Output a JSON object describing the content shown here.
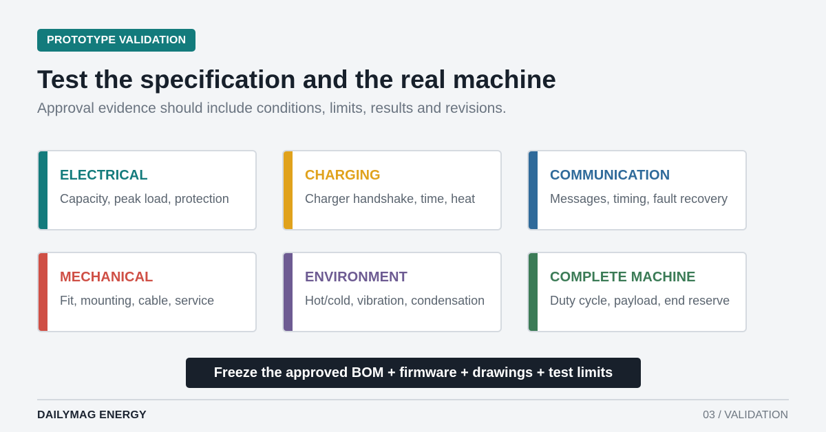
{
  "header": {
    "badge": "PROTOTYPE VALIDATION",
    "title": "Test the specification and the real machine",
    "subtitle": "Approval evidence should include conditions, limits, results and revisions."
  },
  "cards": [
    {
      "title": "ELECTRICAL",
      "text": "Capacity, peak load, protection",
      "color": "#137b7c"
    },
    {
      "title": "CHARGING",
      "text": "Charger handshake, time, heat",
      "color": "#e0a21c"
    },
    {
      "title": "COMMUNICATION",
      "text": "Messages, timing, fault recovery",
      "color": "#2f6a9a"
    },
    {
      "title": "MECHANICAL",
      "text": "Fit, mounting, cable, service",
      "color": "#cf4f45"
    },
    {
      "title": "ENVIRONMENT",
      "text": "Hot/cold, vibration, condensation",
      "color": "#6d5b92"
    },
    {
      "title": "COMPLETE MACHINE",
      "text": "Duty cycle, payload, end reserve",
      "color": "#3b7b56"
    }
  ],
  "cta": "Freeze the approved BOM + firmware + drawings + test limits",
  "footer": {
    "brand": "DAILYMAG ENERGY",
    "page": "03 / VALIDATION"
  }
}
